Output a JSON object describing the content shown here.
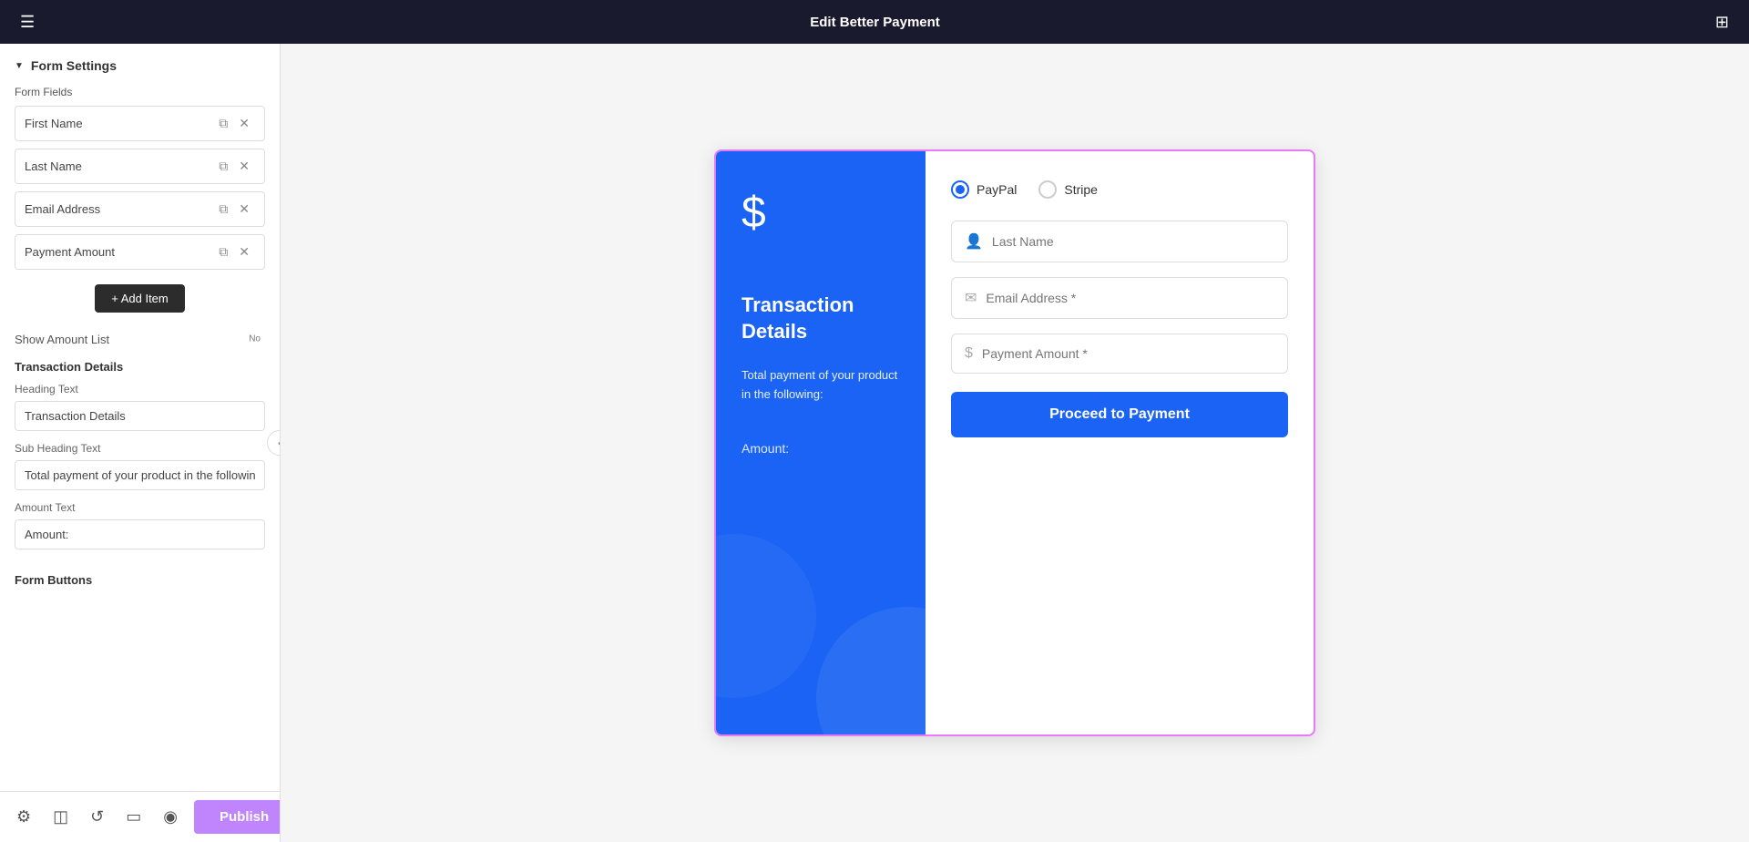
{
  "topbar": {
    "menu_icon": "menu-icon",
    "title": "Edit Better Payment",
    "grid_icon": "grid-icon"
  },
  "left_panel": {
    "form_settings_label": "Form Settings",
    "form_fields_label": "Form Fields",
    "fields": [
      {
        "name": "First Name"
      },
      {
        "name": "Last Name"
      },
      {
        "name": "Email Address"
      },
      {
        "name": "Payment Amount"
      }
    ],
    "add_item_label": "+ Add Item",
    "show_amount_list_label": "Show Amount List",
    "toggle_state": "No",
    "transaction_details_title": "Transaction Details",
    "heading_text_label": "Heading Text",
    "heading_text_value": "Transaction Details",
    "sub_heading_text_label": "Sub Heading Text",
    "sub_heading_text_value": "Total payment of your product in the following:",
    "amount_text_label": "Amount Text",
    "amount_text_value": "Amount:",
    "form_buttons_title": "Form Buttons"
  },
  "bottom_bar": {
    "settings_icon": "settings-icon",
    "layers_icon": "layers-icon",
    "history_icon": "history-icon",
    "device_icon": "device-icon",
    "eye_icon": "eye-icon",
    "publish_label": "Publish",
    "chevron_up_icon": "chevron-up-icon"
  },
  "preview": {
    "card_left": {
      "dollar_symbol": "$",
      "transaction_title": "Transaction Details",
      "transaction_desc": "Total payment of your product in the following:",
      "amount_label": "Amount:"
    },
    "card_right": {
      "payment_methods": [
        {
          "id": "paypal",
          "label": "PayPal",
          "active": true
        },
        {
          "id": "stripe",
          "label": "Stripe",
          "active": false
        }
      ],
      "fields": [
        {
          "placeholder": "Last Name",
          "icon": "user"
        },
        {
          "placeholder": "Email Address *",
          "icon": "mail"
        },
        {
          "placeholder": "Payment Amount *",
          "icon": "dollar"
        }
      ],
      "proceed_btn_label": "Proceed to Payment"
    }
  }
}
